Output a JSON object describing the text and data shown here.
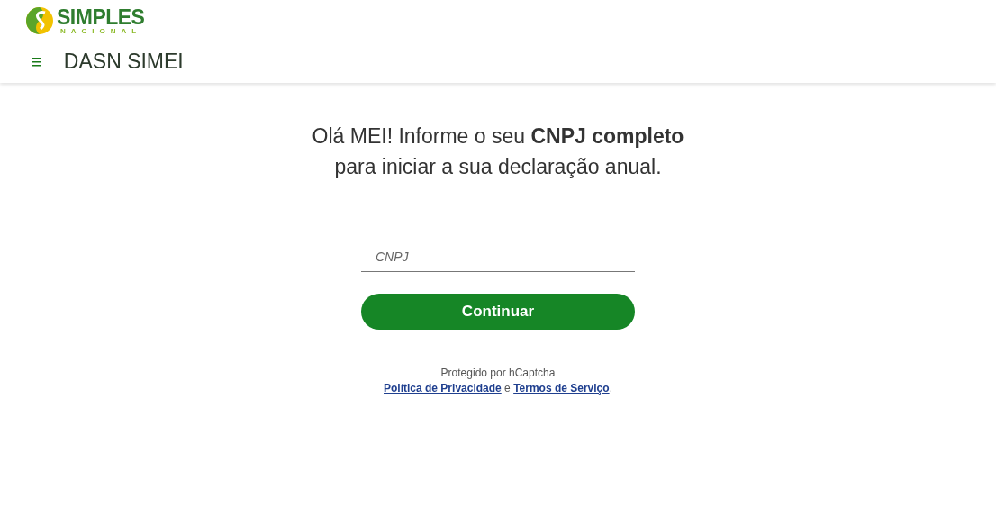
{
  "logo": {
    "title": "SIMPLES",
    "subtitle": "NACIONAL"
  },
  "nav": {
    "menu_icon": "≡",
    "title": "DASN SIMEI"
  },
  "headline": {
    "lines": [
      "Olá MEI! Informe o seu **CNPJ completo**",
      "para iniciar a sua declaração anual."
    ]
  },
  "cnpj_field": {
    "placeholder": "CNPJ"
  },
  "continue_button": {
    "label": "Continuar"
  },
  "captcha": {
    "text": "Protegido por hCaptcha",
    "privacy_link": "Política de Privacidade",
    "joiner": "e",
    "terms_link": "Termos de Serviço",
    "end": "."
  }
}
